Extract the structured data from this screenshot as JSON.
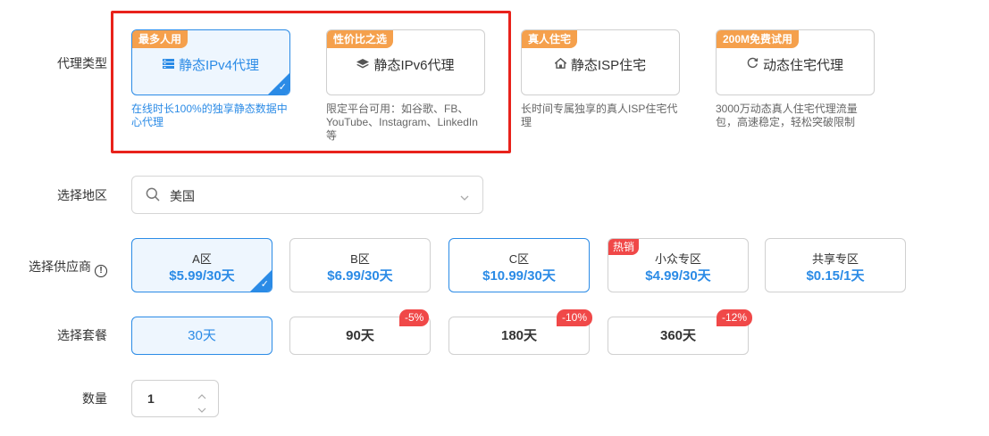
{
  "labels": {
    "proxy_type": "代理类型",
    "region": "选择地区",
    "supplier": "选择供应商",
    "package": "选择套餐",
    "quantity": "数量"
  },
  "proxy_types": [
    {
      "badge": "最多人用",
      "title": "静态IPv4代理",
      "icon": "server-icon",
      "desc": "在线时长100%的独享静态数据中心代理",
      "selected": true
    },
    {
      "badge": "性价比之选",
      "title": "静态IPv6代理",
      "icon": "layers-icon",
      "desc": "限定平台可用：如谷歌、FB、YouTube、Instagram、LinkedIn等",
      "selected": false
    },
    {
      "badge": "真人住宅",
      "title": "静态ISP住宅",
      "icon": "home-icon",
      "desc": "长时间专属独享的真人ISP住宅代理",
      "selected": false
    },
    {
      "badge": "200M免费试用",
      "title": "动态住宅代理",
      "icon": "refresh-icon",
      "desc": "3000万动态真人住宅代理流量包，高速稳定，轻松突破限制",
      "selected": false
    }
  ],
  "region": {
    "value": "美国"
  },
  "suppliers": [
    {
      "name": "A区",
      "price": "$5.99/30天",
      "selected": true
    },
    {
      "name": "B区",
      "price": "$6.99/30天",
      "selected": false
    },
    {
      "name": "C区",
      "price": "$10.99/30天",
      "selected": false
    },
    {
      "name": "小众专区",
      "price": "$4.99/30天",
      "badge": "热销",
      "selected": false
    },
    {
      "name": "共享专区",
      "price": "$0.15/1天",
      "selected": false
    }
  ],
  "packages": [
    {
      "label": "30天",
      "selected": true
    },
    {
      "label": "90天",
      "discount": "-5%"
    },
    {
      "label": "180天",
      "discount": "-10%"
    },
    {
      "label": "360天",
      "discount": "-12%"
    }
  ],
  "quantity": {
    "value": "1"
  },
  "colors": {
    "accent": "#2b8be6",
    "badge_orange": "#f5a04c",
    "badge_red": "#f04848",
    "highlight_frame": "#e8221b"
  }
}
